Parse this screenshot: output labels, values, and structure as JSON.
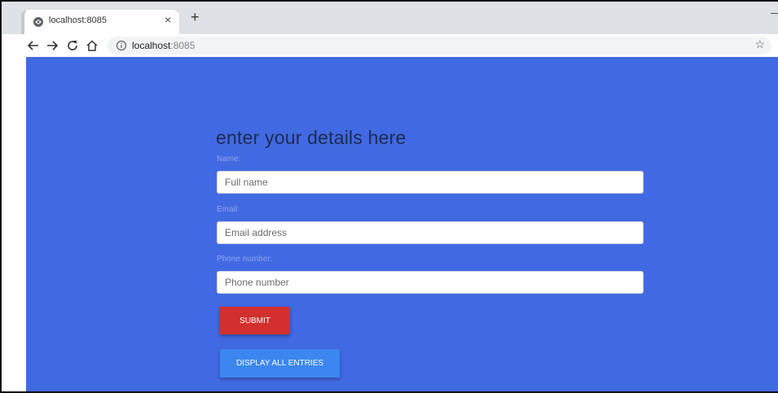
{
  "browser": {
    "tab_title": "localhost:8085",
    "tab_close_label": "×",
    "new_tab_label": "+",
    "url_host": "localhost",
    "url_port": ":8085",
    "star_label": "☆"
  },
  "form": {
    "heading": "enter your details here",
    "name_label": "Name:",
    "name_placeholder": "Full name",
    "email_label": "Email:",
    "email_placeholder": "Email address",
    "phone_label": "Phone number:",
    "phone_placeholder": "Phone number",
    "submit_label": "SUBMIT",
    "display_label": "DISPLAY ALL ENTRIES"
  },
  "colors": {
    "page_background": "#4169e1",
    "submit_button": "#d32f2f",
    "display_button": "#3b86f0"
  },
  "icons": [
    "globe-icon",
    "back-arrow-icon",
    "forward-arrow-icon",
    "reload-icon",
    "home-icon",
    "info-icon",
    "star-icon"
  ]
}
